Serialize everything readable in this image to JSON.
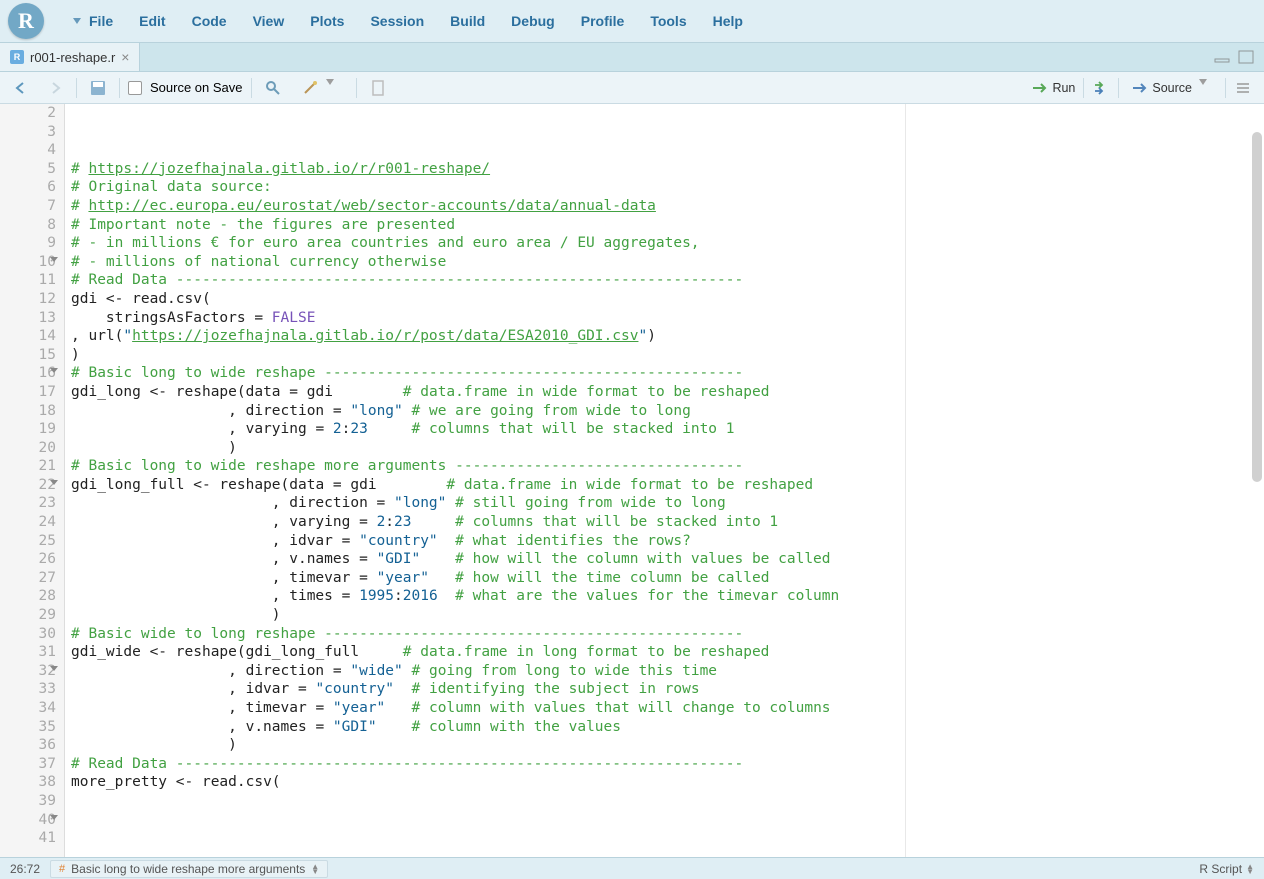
{
  "logo": "R",
  "menus": [
    "File",
    "Edit",
    "Code",
    "View",
    "Plots",
    "Session",
    "Build",
    "Debug",
    "Profile",
    "Tools",
    "Help"
  ],
  "tab": {
    "label": "r001-reshape.r"
  },
  "toolbar": {
    "source_on_save": "Source on Save",
    "run": "Run",
    "source": "Source"
  },
  "status": {
    "pos": "26:72",
    "crumb": "Basic long to wide reshape more arguments",
    "lang": "R Script"
  },
  "code_lines": [
    {
      "n": 2,
      "t": [
        [
          "c-comment",
          "# "
        ],
        [
          "c-url",
          "https://jozefhajnala.gitlab.io/r/r001-reshape/"
        ]
      ]
    },
    {
      "n": 3,
      "t": []
    },
    {
      "n": 4,
      "t": [
        [
          "c-comment",
          "# Original data source:"
        ]
      ]
    },
    {
      "n": 5,
      "t": [
        [
          "c-comment",
          "# "
        ],
        [
          "c-url",
          "http://ec.europa.eu/eurostat/web/sector-accounts/data/annual-data"
        ]
      ]
    },
    {
      "n": 6,
      "t": [
        [
          "c-comment",
          "# Important note - the figures are presented"
        ]
      ]
    },
    {
      "n": 7,
      "t": [
        [
          "c-comment",
          "# - in millions € for euro area countries and euro area / EU aggregates,"
        ]
      ]
    },
    {
      "n": 8,
      "t": [
        [
          "c-comment",
          "# - millions of national currency otherwise"
        ]
      ]
    },
    {
      "n": 9,
      "t": []
    },
    {
      "n": 10,
      "fold": true,
      "t": [
        [
          "c-comment",
          "# Read Data -----------------------------------------------------------------"
        ]
      ]
    },
    {
      "n": 11,
      "t": [
        [
          "c-ident",
          "gdi "
        ],
        [
          "c-op",
          "<- "
        ],
        [
          "c-ident",
          "read.csv("
        ]
      ]
    },
    {
      "n": 12,
      "t": [
        [
          "c-ident",
          "    stringsAsFactors "
        ],
        [
          "c-op",
          "= "
        ],
        [
          "c-key",
          "FALSE"
        ]
      ]
    },
    {
      "n": 13,
      "t": [
        [
          "c-ident",
          ", url("
        ],
        [
          "c-str",
          "\""
        ],
        [
          "c-url",
          "https://jozefhajnala.gitlab.io/r/post/data/ESA2010_GDI.csv"
        ],
        [
          "c-str",
          "\""
        ],
        [
          "c-ident",
          ")"
        ]
      ]
    },
    {
      "n": 14,
      "t": [
        [
          "c-ident",
          ")"
        ]
      ]
    },
    {
      "n": 15,
      "t": []
    },
    {
      "n": 16,
      "fold": true,
      "t": [
        [
          "c-comment",
          "# Basic long to wide reshape ------------------------------------------------"
        ]
      ]
    },
    {
      "n": 17,
      "t": [
        [
          "c-ident",
          "gdi_long "
        ],
        [
          "c-op",
          "<- "
        ],
        [
          "c-ident",
          "reshape(data "
        ],
        [
          "c-op",
          "= "
        ],
        [
          "c-ident",
          "gdi        "
        ],
        [
          "c-comment",
          "# data.frame in wide format to be reshaped"
        ]
      ]
    },
    {
      "n": 18,
      "t": [
        [
          "c-ident",
          "                  , direction "
        ],
        [
          "c-op",
          "= "
        ],
        [
          "c-str",
          "\"long\""
        ],
        [
          "c-ident",
          " "
        ],
        [
          "c-comment",
          "# we are going from wide to long"
        ]
      ]
    },
    {
      "n": 19,
      "t": [
        [
          "c-ident",
          "                  , varying "
        ],
        [
          "c-op",
          "= "
        ],
        [
          "c-num",
          "2"
        ],
        [
          "c-op",
          ":"
        ],
        [
          "c-num",
          "23"
        ],
        [
          "c-ident",
          "     "
        ],
        [
          "c-comment",
          "# columns that will be stacked into 1"
        ]
      ]
    },
    {
      "n": 20,
      "t": [
        [
          "c-ident",
          "                  )"
        ]
      ]
    },
    {
      "n": 21,
      "t": []
    },
    {
      "n": 22,
      "fold": true,
      "t": [
        [
          "c-comment",
          "# Basic long to wide reshape more arguments ---------------------------------"
        ]
      ]
    },
    {
      "n": 23,
      "t": [
        [
          "c-ident",
          "gdi_long_full "
        ],
        [
          "c-op",
          "<- "
        ],
        [
          "c-ident",
          "reshape(data "
        ],
        [
          "c-op",
          "= "
        ],
        [
          "c-ident",
          "gdi        "
        ],
        [
          "c-comment",
          "# data.frame in wide format to be reshaped"
        ]
      ]
    },
    {
      "n": 24,
      "t": [
        [
          "c-ident",
          "                       , direction "
        ],
        [
          "c-op",
          "= "
        ],
        [
          "c-str",
          "\"long\""
        ],
        [
          "c-ident",
          " "
        ],
        [
          "c-comment",
          "# still going from wide to long"
        ]
      ]
    },
    {
      "n": 25,
      "t": [
        [
          "c-ident",
          "                       , varying "
        ],
        [
          "c-op",
          "= "
        ],
        [
          "c-num",
          "2"
        ],
        [
          "c-op",
          ":"
        ],
        [
          "c-num",
          "23"
        ],
        [
          "c-ident",
          "     "
        ],
        [
          "c-comment",
          "# columns that will be stacked into 1"
        ]
      ]
    },
    {
      "n": 26,
      "t": [
        [
          "c-ident",
          "                       , idvar "
        ],
        [
          "c-op",
          "= "
        ],
        [
          "c-str",
          "\"country\""
        ],
        [
          "c-ident",
          "  "
        ],
        [
          "c-comment",
          "# what identifies the rows?"
        ]
      ]
    },
    {
      "n": 27,
      "t": [
        [
          "c-ident",
          "                       , v.names "
        ],
        [
          "c-op",
          "= "
        ],
        [
          "c-str",
          "\"GDI\""
        ],
        [
          "c-ident",
          "    "
        ],
        [
          "c-comment",
          "# how will the column with values be called"
        ]
      ]
    },
    {
      "n": 28,
      "t": [
        [
          "c-ident",
          "                       , timevar "
        ],
        [
          "c-op",
          "= "
        ],
        [
          "c-str",
          "\"year\""
        ],
        [
          "c-ident",
          "   "
        ],
        [
          "c-comment",
          "# how will the time column be called"
        ]
      ]
    },
    {
      "n": 29,
      "t": [
        [
          "c-ident",
          "                       , times "
        ],
        [
          "c-op",
          "= "
        ],
        [
          "c-num",
          "1995"
        ],
        [
          "c-op",
          ":"
        ],
        [
          "c-num",
          "2016"
        ],
        [
          "c-ident",
          "  "
        ],
        [
          "c-comment",
          "# what are the values for the timevar column"
        ]
      ]
    },
    {
      "n": 30,
      "t": [
        [
          "c-ident",
          "                       )"
        ]
      ]
    },
    {
      "n": 31,
      "t": []
    },
    {
      "n": 32,
      "fold": true,
      "t": [
        [
          "c-comment",
          "# Basic wide to long reshape ------------------------------------------------"
        ]
      ]
    },
    {
      "n": 33,
      "t": [
        [
          "c-ident",
          "gdi_wide "
        ],
        [
          "c-op",
          "<- "
        ],
        [
          "c-ident",
          "reshape(gdi_long_full     "
        ],
        [
          "c-comment",
          "# data.frame in long format to be reshaped"
        ]
      ]
    },
    {
      "n": 34,
      "t": [
        [
          "c-ident",
          "                  , direction "
        ],
        [
          "c-op",
          "= "
        ],
        [
          "c-str",
          "\"wide\""
        ],
        [
          "c-ident",
          " "
        ],
        [
          "c-comment",
          "# going from long to wide this time"
        ]
      ]
    },
    {
      "n": 35,
      "t": [
        [
          "c-ident",
          "                  , idvar "
        ],
        [
          "c-op",
          "= "
        ],
        [
          "c-str",
          "\"country\""
        ],
        [
          "c-ident",
          "  "
        ],
        [
          "c-comment",
          "# identifying the subject in rows"
        ]
      ]
    },
    {
      "n": 36,
      "t": [
        [
          "c-ident",
          "                  , timevar "
        ],
        [
          "c-op",
          "= "
        ],
        [
          "c-str",
          "\"year\""
        ],
        [
          "c-ident",
          "   "
        ],
        [
          "c-comment",
          "# column with values that will change to columns"
        ]
      ]
    },
    {
      "n": 37,
      "t": [
        [
          "c-ident",
          "                  , v.names "
        ],
        [
          "c-op",
          "= "
        ],
        [
          "c-str",
          "\"GDI\""
        ],
        [
          "c-ident",
          "    "
        ],
        [
          "c-comment",
          "# column with the values"
        ]
      ]
    },
    {
      "n": 38,
      "t": [
        [
          "c-ident",
          "                  )"
        ]
      ]
    },
    {
      "n": 39,
      "t": []
    },
    {
      "n": 40,
      "fold": true,
      "t": [
        [
          "c-comment",
          "# Read Data -----------------------------------------------------------------"
        ]
      ]
    },
    {
      "n": 41,
      "t": [
        [
          "c-ident",
          "more_pretty "
        ],
        [
          "c-op",
          "<- "
        ],
        [
          "c-ident",
          "read.csv("
        ]
      ]
    }
  ],
  "cursor_line": 26
}
